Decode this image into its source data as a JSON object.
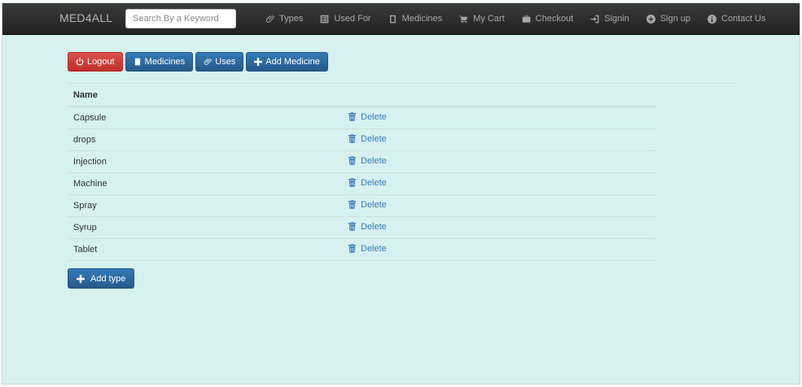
{
  "navbar": {
    "brand": "MED4ALL",
    "search_placeholder": "Search By a Keyword",
    "items": [
      {
        "label": "Types",
        "icon": "paperclip-icon"
      },
      {
        "label": "Used For",
        "icon": "list-icon"
      },
      {
        "label": "Medicines",
        "icon": "book-icon"
      },
      {
        "label": "My Cart",
        "icon": "cart-icon"
      },
      {
        "label": "Checkout",
        "icon": "briefcase-icon"
      },
      {
        "label": "Signin",
        "icon": "login-icon"
      },
      {
        "label": "Sign up",
        "icon": "plus-circle-icon"
      },
      {
        "label": "Contact Us",
        "icon": "info-icon"
      }
    ]
  },
  "toolbar": {
    "logout_label": "Logout",
    "medicines_label": "Medicines",
    "uses_label": "Uses",
    "add_medicine_label": "Add Medicine"
  },
  "table": {
    "header_name": "Name",
    "delete_label": "Delete",
    "rows": [
      "Capsule",
      "drops",
      "Injection",
      "Machine",
      "Spray",
      "Syrup",
      "Tablet"
    ]
  },
  "add_type_label": "Add type",
  "colors": {
    "background": "#d6f1f0",
    "navbar": "#2b2b2b",
    "danger": "#d9534f",
    "primary": "#337ab7",
    "link": "#3b7bbf"
  }
}
